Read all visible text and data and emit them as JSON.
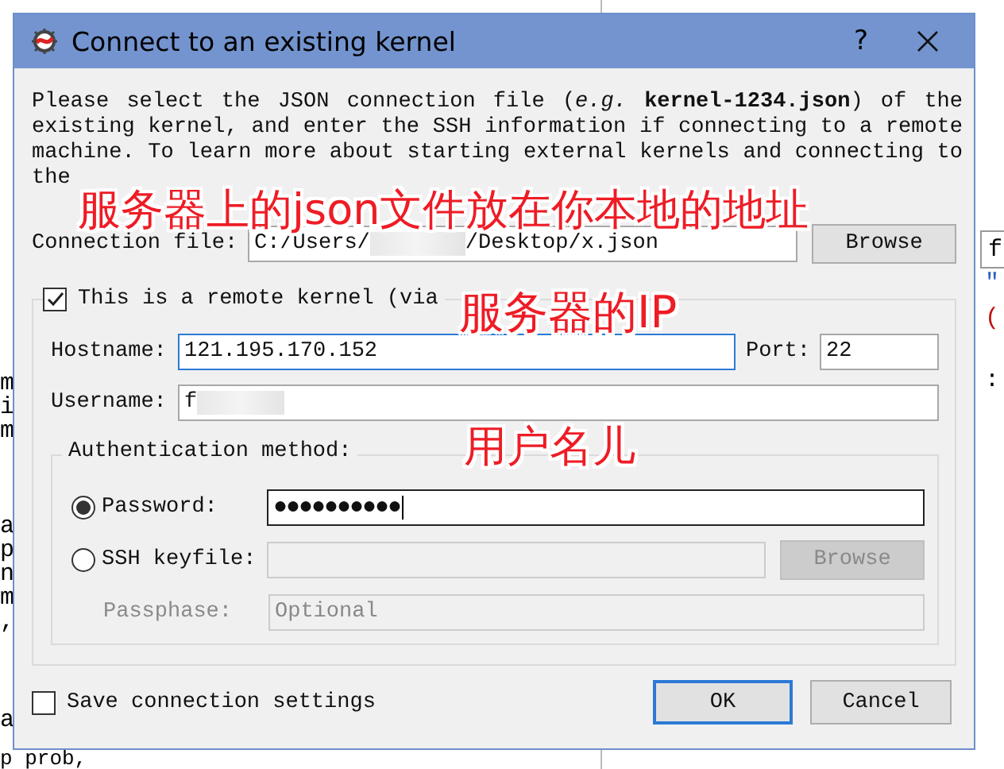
{
  "background": {
    "left_lines": [
      "m",
      "i",
      "m",
      "a",
      "p",
      "n",
      "m",
      ",",
      "a",
      "p prob,"
    ],
    "right_lines": [
      {
        "text": "f",
        "color": "#000000"
      },
      {
        "text": "\"",
        "color": "#3060c0"
      },
      {
        "text": "(",
        "color": "#c01010"
      },
      {
        "text": ":",
        "color": "#000000"
      }
    ]
  },
  "dialog": {
    "title": "Connect to an existing kernel",
    "help_button": "?",
    "intro": "Please select the JSON connection file (*e.g.* **kernel-1234.json**) of the existing kernel, and enter the SSH information if connecting to a remote machine. To learn more about starting external kernels and connecting to the",
    "connection_file": {
      "label": "Connection file:",
      "value_start": "C:/Users/",
      "value_end": "/Desktop/x.json",
      "button": "Browse"
    },
    "remote": {
      "label": "This is a remote kernel (via",
      "checked": true,
      "hostname": {
        "label": "Hostname:",
        "value": "121.195.170.152",
        "focused": true
      },
      "port": {
        "label": "Port:",
        "value": "22"
      },
      "username": {
        "label": "Username:",
        "value": "f"
      },
      "auth": {
        "title": "Authentication method:",
        "options": [
          {
            "kind": "password",
            "label": "Password:",
            "selected": true,
            "value": "●●●●●●●●●●"
          },
          {
            "kind": "keyfile",
            "label": "SSH keyfile:",
            "selected": false,
            "button": "Browse",
            "disabled": true
          }
        ],
        "passphrase": {
          "label": "Passphase:",
          "placeholder": "Optional",
          "disabled": true
        }
      }
    },
    "save": {
      "label": "Save connection settings",
      "checked": false
    },
    "buttons": [
      {
        "label": "OK",
        "default": true
      },
      {
        "label": "Cancel",
        "default": false
      }
    ]
  },
  "annotations": [
    "服务器上的json文件放在你本地的地址",
    "服务器的IP",
    "用户名儿"
  ]
}
